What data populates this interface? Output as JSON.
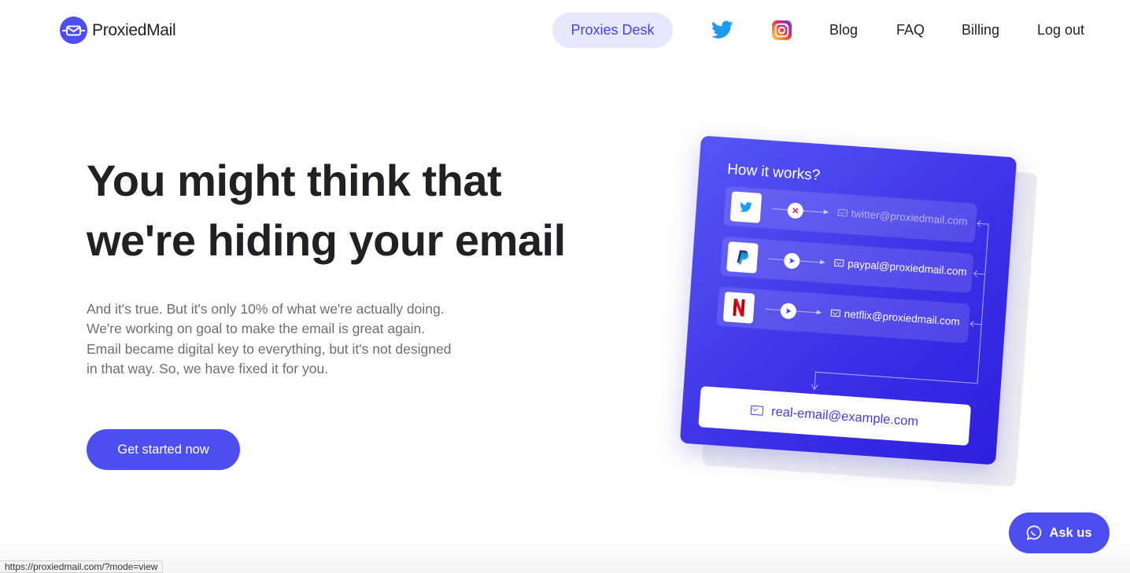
{
  "header": {
    "brand_name": "ProxiedMail",
    "nav": {
      "proxies_desk": "Proxies Desk",
      "twitter_icon": "twitter-icon",
      "instagram_icon": "instagram-icon",
      "blog": "Blog",
      "faq": "FAQ",
      "billing": "Billing",
      "logout": "Log out"
    }
  },
  "hero": {
    "title_line1": "You might think that",
    "title_line2": "we're hiding your email",
    "body_line1": "And it's true. But it's only 10% of what we're actually doing. We're working on goal to make the email is great again.",
    "body_line2": "Email became digital key to everything, but it's not designed in that way. So, we have fixed it for you.",
    "cta_label": "Get started now"
  },
  "illustration": {
    "title": "How it works?",
    "rows": [
      {
        "service": "twitter",
        "status": "blocked",
        "address": "twitter@proxiedmail.com"
      },
      {
        "service": "paypal",
        "status": "forwarded",
        "address": "paypal@proxiedmail.com"
      },
      {
        "service": "netflix",
        "status": "forwarded",
        "address": "netflix@proxiedmail.com"
      }
    ],
    "real_email": "real-email@example.com"
  },
  "chat": {
    "label": "Ask us"
  },
  "status_bar": {
    "url": "https://proxiedmail.com/?mode=view"
  },
  "colors": {
    "accent": "#4c4ef0",
    "accent_light": "#e7e8fd",
    "text": "#202124",
    "muted": "#6b6e75"
  }
}
